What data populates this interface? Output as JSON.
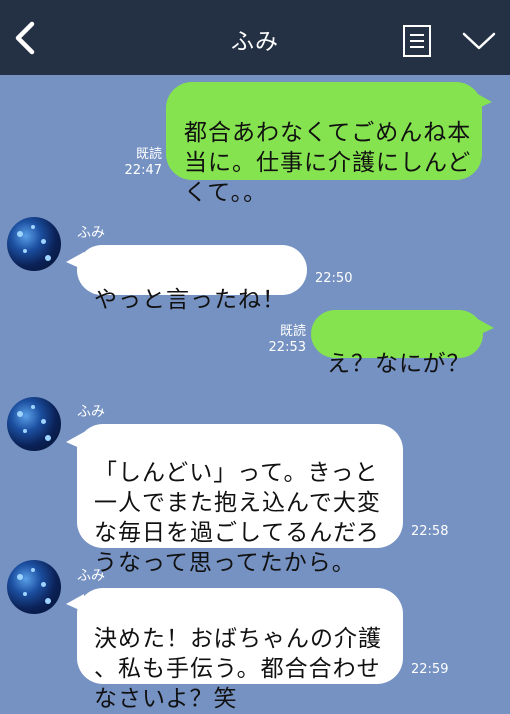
{
  "header": {
    "title": "ふみ"
  },
  "messages": [
    {
      "side": "sent",
      "text": "都合あわなくてごめんね本\n当に。仕事に介護にしんど\nくて。。",
      "read": "既読",
      "time": "22:47"
    },
    {
      "side": "recv",
      "sender": "ふみ",
      "text": "やっと言ったね！",
      "time": "22:50"
    },
    {
      "side": "sent",
      "text": "え？なにが？",
      "read": "既読",
      "time": "22:53"
    },
    {
      "side": "recv",
      "sender": "ふみ",
      "text": "「しんどい」って。きっと\n一人でまた抱え込んで大変\nな毎日を過ごしてるんだろ\nうなって思ってたから。",
      "time": "22:58"
    },
    {
      "side": "recv",
      "sender": "ふみ",
      "text": "決めた！おばちゃんの介護\n、私も手伝う。都合合わせ\nなさいよ？笑",
      "time": "22:59"
    }
  ],
  "icons": {
    "back": "chevron-left-icon",
    "notes": "notes-icon",
    "menu": "chevron-down-icon",
    "avatar": "avatar"
  },
  "colors": {
    "header_bg": "#243044",
    "chat_bg": "#7592c2",
    "sent_bubble": "#84e34e",
    "recv_bubble": "#ffffff"
  }
}
